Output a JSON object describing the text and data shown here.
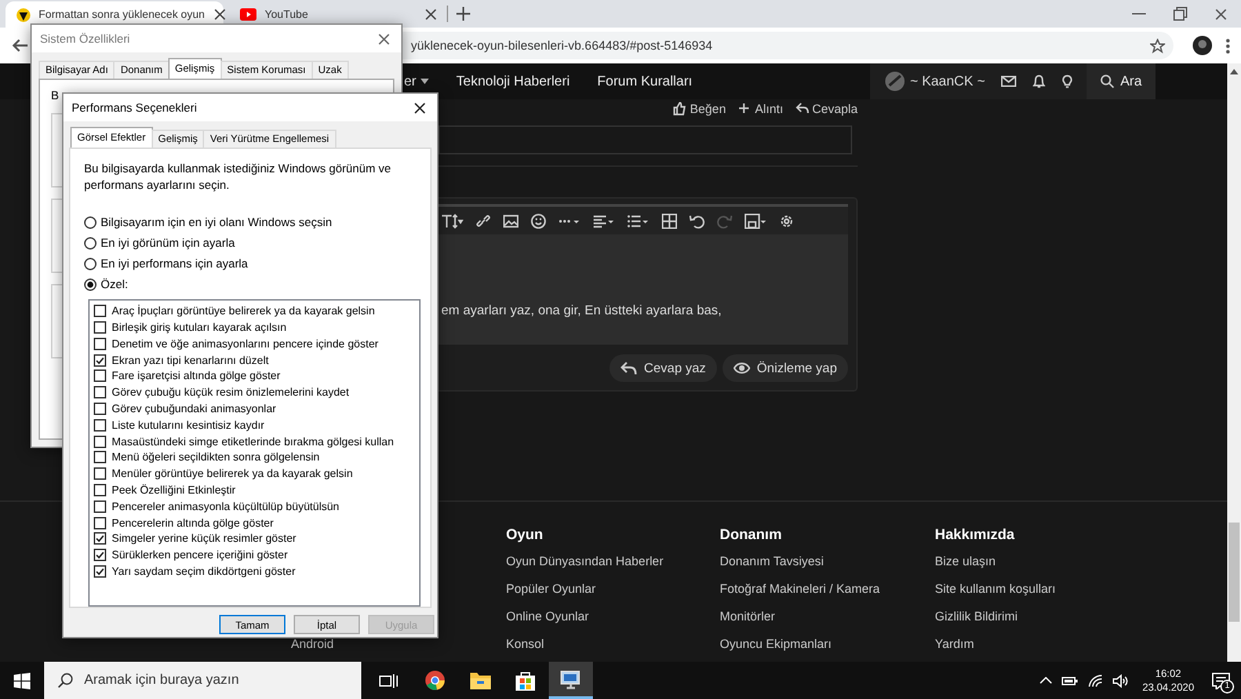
{
  "browser": {
    "tabs": [
      {
        "title": "Formattan sonra yüklenecek oyun",
        "kind": "site",
        "selected": true
      },
      {
        "title": "YouTube",
        "kind": "youtube",
        "selected": false
      }
    ],
    "url": "yüklenecek-oyun-bilesenleri-vb.664483/#post-5146934"
  },
  "site": {
    "nav": [
      {
        "label": "er",
        "dropdown": true
      },
      {
        "label": "Teknoloji Haberleri",
        "dropdown": false
      },
      {
        "label": "Forum Kuralları",
        "dropdown": false
      }
    ],
    "user": "~ KaanCK ~",
    "search": "Ara",
    "post_actions": [
      {
        "label": "Beğen",
        "kind": "like"
      },
      {
        "label": "Alıntı",
        "kind": "quote"
      },
      {
        "label": "Cevapla",
        "kind": "reply"
      }
    ],
    "editor_text": "em ayarları yaz, ona gir, En üstteki ayarlara bas,",
    "editor_buttons": [
      {
        "label": "Cevap yaz",
        "kind": "reply"
      },
      {
        "label": "Önizleme yap",
        "kind": "preview"
      }
    ],
    "footer": {
      "partial_link": "Android",
      "columns": [
        {
          "heading": "Oyun",
          "links": [
            "Oyun Dünyasından Haberler",
            "Popüler Oyunlar",
            "Online Oyunlar",
            "Konsol"
          ]
        },
        {
          "heading": "Donanım",
          "links": [
            "Donanım Tavsiyesi",
            "Fotoğraf Makineleri / Kamera",
            "Monitörler",
            "Oyuncu Ekipmanları"
          ]
        },
        {
          "heading": "Hakkımızda",
          "links": [
            "Bize ulaşın",
            "Site kullanım koşulları",
            "Gizlilik Bildirimi",
            "Yardım"
          ]
        }
      ]
    }
  },
  "system_properties": {
    "title": "Sistem Özellikleri",
    "fragment": "B",
    "tabs": [
      {
        "label": "Bilgisayar Adı",
        "selected": false
      },
      {
        "label": "Donanım",
        "selected": false
      },
      {
        "label": "Gelişmiş",
        "selected": true
      },
      {
        "label": "Sistem Koruması",
        "selected": false
      },
      {
        "label": "Uzak",
        "selected": false
      }
    ]
  },
  "performance_options": {
    "title": "Performans Seçenekleri",
    "tabs": [
      {
        "label": "Görsel Efektler",
        "selected": true
      },
      {
        "label": "Gelişmiş",
        "selected": false
      },
      {
        "label": "Veri Yürütme Engellemesi",
        "selected": false
      }
    ],
    "description": "Bu bilgisayarda kullanmak istediğiniz Windows görünüm ve performans ayarlarını seçin.",
    "options": [
      {
        "label": "Bilgisayarım için en iyi olanı Windows seçsin",
        "selected": false
      },
      {
        "label": "En iyi görünüm için ayarla",
        "selected": false
      },
      {
        "label": "En iyi performans için ayarla",
        "selected": false
      },
      {
        "label": "Özel:",
        "selected": true
      }
    ],
    "effects": [
      {
        "label": "Araç İpuçları görüntüye belirerek ya da kayarak gelsin",
        "checked": false
      },
      {
        "label": "Birleşik giriş kutuları kayarak açılsın",
        "checked": false
      },
      {
        "label": "Denetim ve öğe animasyonlarını pencere içinde göster",
        "checked": false
      },
      {
        "label": "Ekran yazı tipi kenarlarını düzelt",
        "checked": true
      },
      {
        "label": "Fare işaretçisi altında gölge göster",
        "checked": false
      },
      {
        "label": "Görev çubuğu küçük resim önizlemelerini kaydet",
        "checked": false
      },
      {
        "label": "Görev çubuğundaki animasyonlar",
        "checked": false
      },
      {
        "label": "Liste kutularını kesintisiz kaydır",
        "checked": false
      },
      {
        "label": "Masaüstündeki simge etiketlerinde bırakma gölgesi kullan",
        "checked": false
      },
      {
        "label": "Menü öğeleri seçildikten sonra gölgelensin",
        "checked": false
      },
      {
        "label": "Menüler görüntüye belirerek ya da kayarak gelsin",
        "checked": false
      },
      {
        "label": "Peek Özelliğini Etkinleştir",
        "checked": false
      },
      {
        "label": "Pencereler animasyonla küçültülüp büyütülsün",
        "checked": false
      },
      {
        "label": "Pencerelerin altında gölge göster",
        "checked": false
      },
      {
        "label": "Simgeler yerine küçük resimler göster",
        "checked": true
      },
      {
        "label": "Sürüklerken pencere içeriğini göster",
        "checked": true
      },
      {
        "label": "Yarı saydam seçim dikdörtgeni göster",
        "checked": true
      }
    ],
    "buttons": [
      {
        "label": "Tamam",
        "default": true,
        "disabled": false
      },
      {
        "label": "İptal",
        "default": false,
        "disabled": false
      },
      {
        "label": "Uygula",
        "default": false,
        "disabled": true
      }
    ]
  },
  "taskbar": {
    "search_placeholder": "Aramak için buraya yazın",
    "apps": [
      {
        "kind": "taskview",
        "active": false
      },
      {
        "kind": "chrome",
        "active": false
      },
      {
        "kind": "explorer",
        "active": false
      },
      {
        "kind": "store",
        "active": false
      },
      {
        "kind": "system",
        "active": true
      }
    ],
    "time": "16:02",
    "date": "23.04.2020",
    "notifications": "1"
  }
}
